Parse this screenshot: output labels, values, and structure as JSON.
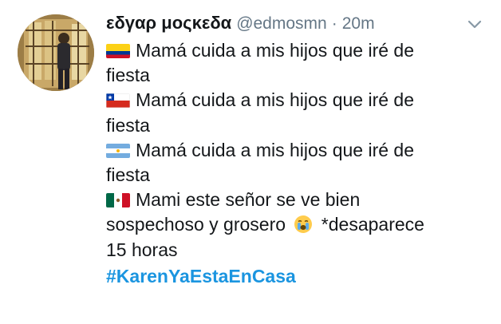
{
  "tweet": {
    "display_name": "εδγαρ μοςκεδα",
    "handle": "@edmosmn",
    "separator": "·",
    "time": "20m",
    "lines": [
      {
        "flag": "colombia-flag-icon",
        "text": "Mamá cuida a mis hijos que iré de"
      },
      {
        "text": "fiesta"
      },
      {
        "flag": "chile-flag-icon",
        "text": "Mamá cuida a mis hijos que iré de"
      },
      {
        "text": "fiesta"
      },
      {
        "flag": "argentina-flag-icon",
        "text": "Mamá cuida a mis hijos que iré de"
      },
      {
        "text": "fiesta"
      },
      {
        "flag": "mexico-flag-icon",
        "text": "Mami este señor se ve bien"
      },
      {
        "text_before_emoji": "sospechoso y grosero",
        "emoji": "crying-face-icon",
        "text_after_emoji": "*desaparece"
      },
      {
        "text": "15 horas"
      }
    ],
    "hashtag": "#KarenYaEstaEnCasa",
    "colors": {
      "hashtag": "#1b95e0",
      "secondary_text": "#657786",
      "primary_text": "#14171a"
    }
  }
}
